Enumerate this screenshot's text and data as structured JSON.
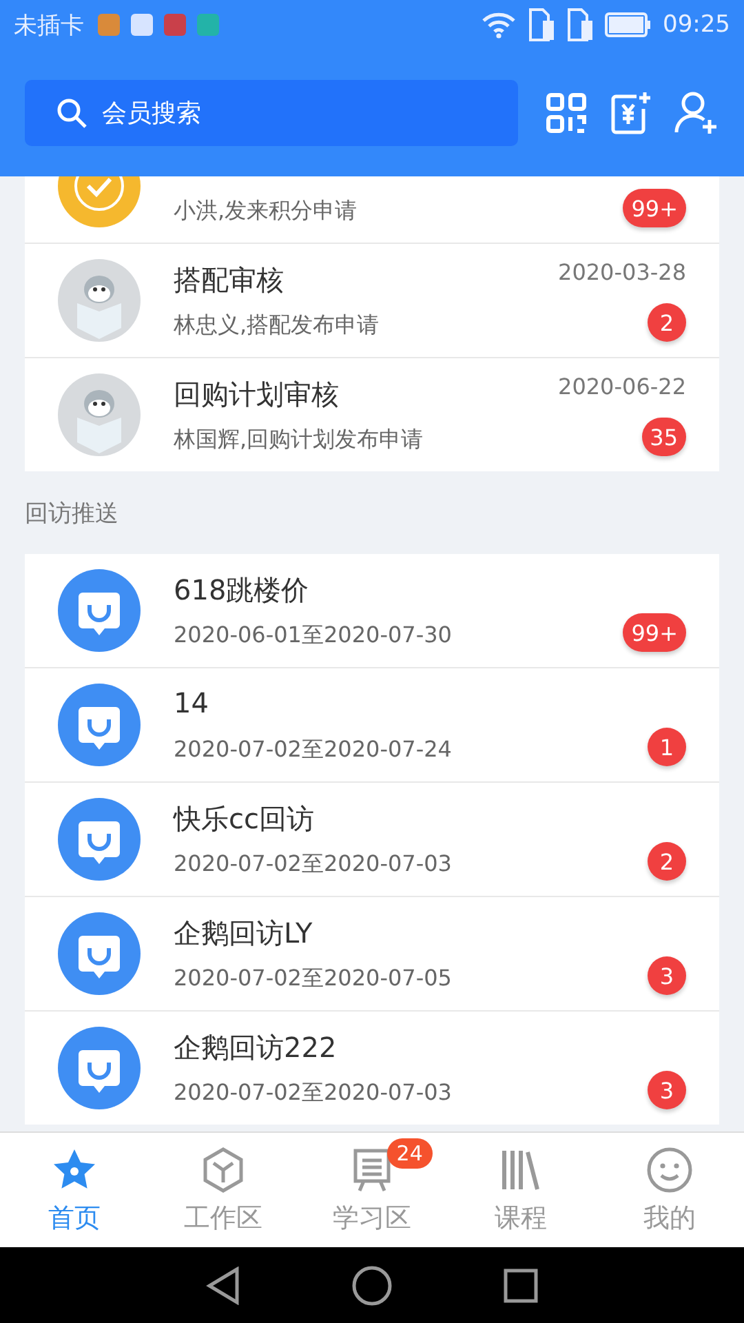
{
  "status_bar": {
    "carrier": "未插卡",
    "time": "09:25"
  },
  "header": {
    "search": {
      "placeholder": "会员搜索"
    }
  },
  "audit_items": [
    {
      "kind": "points",
      "subtitle": "小洪,发来积分申请",
      "badge": "99+"
    },
    {
      "kind": "penguin",
      "title": "搭配审核",
      "date": "2020-03-28",
      "subtitle": "林忠义,搭配发布申请",
      "badge": "2"
    },
    {
      "kind": "penguin",
      "title": "回购计划审核",
      "date": "2020-06-22",
      "subtitle": "林国辉,回购计划发布申请",
      "badge": "35"
    }
  ],
  "section_title": "回访推送",
  "visit_items": [
    {
      "kind": "visit",
      "title": "618跳楼价",
      "subtitle": "2020-06-01至2020-07-30",
      "badge": "99+"
    },
    {
      "kind": "visit",
      "title": "14",
      "subtitle": "2020-07-02至2020-07-24",
      "badge": "1"
    },
    {
      "kind": "visit",
      "title": "快乐cc回访",
      "subtitle": "2020-07-02至2020-07-03",
      "badge": "2"
    },
    {
      "kind": "visit",
      "title": "企鹅回访LY",
      "subtitle": "2020-07-02至2020-07-05",
      "badge": "3"
    },
    {
      "kind": "visit",
      "title": "企鹅回访222",
      "subtitle": "2020-07-02至2020-07-03",
      "badge": "3"
    }
  ],
  "tabs": [
    {
      "label": "首页",
      "selected": true,
      "kind": "home"
    },
    {
      "label": "工作区",
      "selected": false,
      "kind": "work"
    },
    {
      "label": "学习区",
      "selected": false,
      "kind": "study",
      "badge": "24"
    },
    {
      "label": "课程",
      "selected": false,
      "kind": "course"
    },
    {
      "label": "我的",
      "selected": false,
      "kind": "me"
    }
  ]
}
